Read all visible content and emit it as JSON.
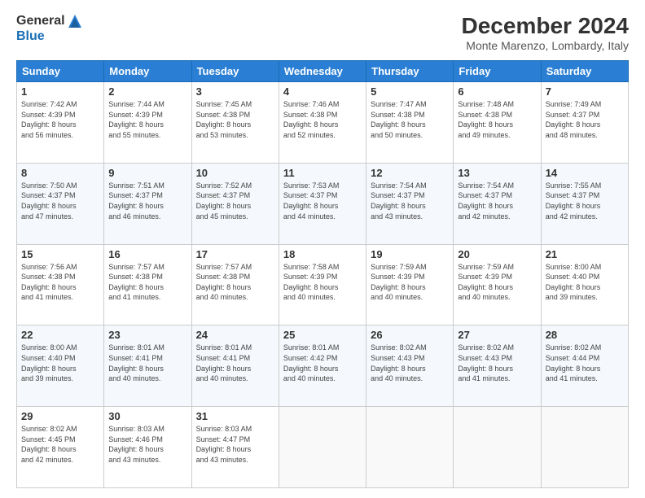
{
  "header": {
    "logo_general": "General",
    "logo_blue": "Blue",
    "main_title": "December 2024",
    "subtitle": "Monte Marenzo, Lombardy, Italy"
  },
  "calendar": {
    "days_of_week": [
      "Sunday",
      "Monday",
      "Tuesday",
      "Wednesday",
      "Thursday",
      "Friday",
      "Saturday"
    ],
    "weeks": [
      [
        {
          "day": "1",
          "info": "Sunrise: 7:42 AM\nSunset: 4:39 PM\nDaylight: 8 hours\nand 56 minutes."
        },
        {
          "day": "2",
          "info": "Sunrise: 7:44 AM\nSunset: 4:39 PM\nDaylight: 8 hours\nand 55 minutes."
        },
        {
          "day": "3",
          "info": "Sunrise: 7:45 AM\nSunset: 4:38 PM\nDaylight: 8 hours\nand 53 minutes."
        },
        {
          "day": "4",
          "info": "Sunrise: 7:46 AM\nSunset: 4:38 PM\nDaylight: 8 hours\nand 52 minutes."
        },
        {
          "day": "5",
          "info": "Sunrise: 7:47 AM\nSunset: 4:38 PM\nDaylight: 8 hours\nand 50 minutes."
        },
        {
          "day": "6",
          "info": "Sunrise: 7:48 AM\nSunset: 4:38 PM\nDaylight: 8 hours\nand 49 minutes."
        },
        {
          "day": "7",
          "info": "Sunrise: 7:49 AM\nSunset: 4:37 PM\nDaylight: 8 hours\nand 48 minutes."
        }
      ],
      [
        {
          "day": "8",
          "info": "Sunrise: 7:50 AM\nSunset: 4:37 PM\nDaylight: 8 hours\nand 47 minutes."
        },
        {
          "day": "9",
          "info": "Sunrise: 7:51 AM\nSunset: 4:37 PM\nDaylight: 8 hours\nand 46 minutes."
        },
        {
          "day": "10",
          "info": "Sunrise: 7:52 AM\nSunset: 4:37 PM\nDaylight: 8 hours\nand 45 minutes."
        },
        {
          "day": "11",
          "info": "Sunrise: 7:53 AM\nSunset: 4:37 PM\nDaylight: 8 hours\nand 44 minutes."
        },
        {
          "day": "12",
          "info": "Sunrise: 7:54 AM\nSunset: 4:37 PM\nDaylight: 8 hours\nand 43 minutes."
        },
        {
          "day": "13",
          "info": "Sunrise: 7:54 AM\nSunset: 4:37 PM\nDaylight: 8 hours\nand 42 minutes."
        },
        {
          "day": "14",
          "info": "Sunrise: 7:55 AM\nSunset: 4:37 PM\nDaylight: 8 hours\nand 42 minutes."
        }
      ],
      [
        {
          "day": "15",
          "info": "Sunrise: 7:56 AM\nSunset: 4:38 PM\nDaylight: 8 hours\nand 41 minutes."
        },
        {
          "day": "16",
          "info": "Sunrise: 7:57 AM\nSunset: 4:38 PM\nDaylight: 8 hours\nand 41 minutes."
        },
        {
          "day": "17",
          "info": "Sunrise: 7:57 AM\nSunset: 4:38 PM\nDaylight: 8 hours\nand 40 minutes."
        },
        {
          "day": "18",
          "info": "Sunrise: 7:58 AM\nSunset: 4:39 PM\nDaylight: 8 hours\nand 40 minutes."
        },
        {
          "day": "19",
          "info": "Sunrise: 7:59 AM\nSunset: 4:39 PM\nDaylight: 8 hours\nand 40 minutes."
        },
        {
          "day": "20",
          "info": "Sunrise: 7:59 AM\nSunset: 4:39 PM\nDaylight: 8 hours\nand 40 minutes."
        },
        {
          "day": "21",
          "info": "Sunrise: 8:00 AM\nSunset: 4:40 PM\nDaylight: 8 hours\nand 39 minutes."
        }
      ],
      [
        {
          "day": "22",
          "info": "Sunrise: 8:00 AM\nSunset: 4:40 PM\nDaylight: 8 hours\nand 39 minutes."
        },
        {
          "day": "23",
          "info": "Sunrise: 8:01 AM\nSunset: 4:41 PM\nDaylight: 8 hours\nand 40 minutes."
        },
        {
          "day": "24",
          "info": "Sunrise: 8:01 AM\nSunset: 4:41 PM\nDaylight: 8 hours\nand 40 minutes."
        },
        {
          "day": "25",
          "info": "Sunrise: 8:01 AM\nSunset: 4:42 PM\nDaylight: 8 hours\nand 40 minutes."
        },
        {
          "day": "26",
          "info": "Sunrise: 8:02 AM\nSunset: 4:43 PM\nDaylight: 8 hours\nand 40 minutes."
        },
        {
          "day": "27",
          "info": "Sunrise: 8:02 AM\nSunset: 4:43 PM\nDaylight: 8 hours\nand 41 minutes."
        },
        {
          "day": "28",
          "info": "Sunrise: 8:02 AM\nSunset: 4:44 PM\nDaylight: 8 hours\nand 41 minutes."
        }
      ],
      [
        {
          "day": "29",
          "info": "Sunrise: 8:02 AM\nSunset: 4:45 PM\nDaylight: 8 hours\nand 42 minutes."
        },
        {
          "day": "30",
          "info": "Sunrise: 8:03 AM\nSunset: 4:46 PM\nDaylight: 8 hours\nand 43 minutes."
        },
        {
          "day": "31",
          "info": "Sunrise: 8:03 AM\nSunset: 4:47 PM\nDaylight: 8 hours\nand 43 minutes."
        },
        null,
        null,
        null,
        null
      ]
    ]
  }
}
